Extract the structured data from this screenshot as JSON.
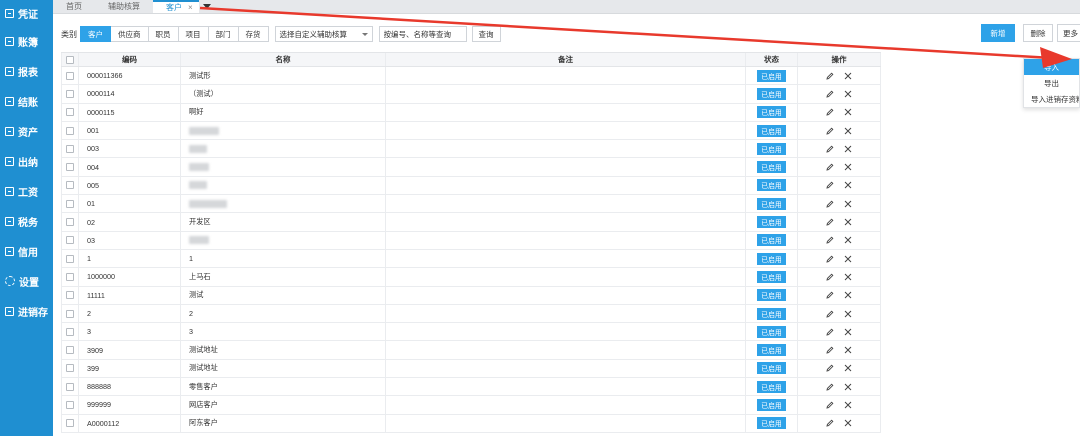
{
  "sidebar": {
    "items": [
      {
        "label": "凭证",
        "icon": "voucher-icon"
      },
      {
        "label": "账簿",
        "icon": "ledger-icon"
      },
      {
        "label": "报表",
        "icon": "report-icon"
      },
      {
        "label": "结账",
        "icon": "checkout-icon"
      },
      {
        "label": "资产",
        "icon": "asset-icon"
      },
      {
        "label": "出纳",
        "icon": "cashier-icon"
      },
      {
        "label": "工资",
        "icon": "salary-icon"
      },
      {
        "label": "税务",
        "icon": "tax-icon"
      },
      {
        "label": "信用",
        "icon": "credit-icon"
      },
      {
        "label": "设置",
        "icon": "gear-icon"
      },
      {
        "label": "进销存",
        "icon": "inventory-icon"
      }
    ]
  },
  "tabs": [
    {
      "label": "首页"
    },
    {
      "label": "辅助核算"
    },
    {
      "label": "客户",
      "close": "×"
    }
  ],
  "toolbar": {
    "category_label": "类别",
    "categories": [
      "客户",
      "供应商",
      "职员",
      "项目",
      "部门",
      "存货"
    ],
    "custom_select": "选择自定义辅助核算",
    "search_placeholder": "按编号、名称等查询",
    "query_label": "查询",
    "new_label": "新增",
    "delete_label": "删除",
    "more_label": "更多"
  },
  "dropdown": {
    "items": [
      "导入",
      "导出",
      "导入进销存资料"
    ]
  },
  "table": {
    "headers": {
      "code": "编码",
      "name": "名称",
      "note": "备注",
      "status": "状态",
      "op": "操作"
    },
    "rows": [
      {
        "code": "000011366",
        "name": "测试形",
        "status": "已启用"
      },
      {
        "code": "0000114",
        "name": "（测试）",
        "status": "已启用"
      },
      {
        "code": "0000115",
        "name": "啊好",
        "status": "已启用"
      },
      {
        "code": "001",
        "name": "",
        "status": "已启用"
      },
      {
        "code": "003",
        "name": "",
        "status": "已启用"
      },
      {
        "code": "004",
        "name": "",
        "status": "已启用"
      },
      {
        "code": "005",
        "name": "",
        "status": "已启用"
      },
      {
        "code": "01",
        "name": "",
        "status": "已启用"
      },
      {
        "code": "02",
        "name": "开发区",
        "status": "已启用"
      },
      {
        "code": "03",
        "name": "",
        "status": "已启用"
      },
      {
        "code": "1",
        "name": "1",
        "status": "已启用"
      },
      {
        "code": "1000000",
        "name": "上马石",
        "status": "已启用"
      },
      {
        "code": "11111",
        "name": "测试",
        "status": "已启用"
      },
      {
        "code": "2",
        "name": "2",
        "status": "已启用"
      },
      {
        "code": "3",
        "name": "3",
        "status": "已启用"
      },
      {
        "code": "3909",
        "name": "测试地址",
        "status": "已启用"
      },
      {
        "code": "399",
        "name": "测试地址",
        "status": "已启用"
      },
      {
        "code": "888888",
        "name": "零售客户",
        "status": "已启用"
      },
      {
        "code": "999999",
        "name": "网店客户",
        "status": "已启用"
      },
      {
        "code": "A0000112",
        "name": "阿东客户",
        "status": "已启用"
      }
    ]
  },
  "colors": {
    "sidebar": "#1f8fd1",
    "accent": "#2ea2e8",
    "arrow": "#e8392c"
  }
}
